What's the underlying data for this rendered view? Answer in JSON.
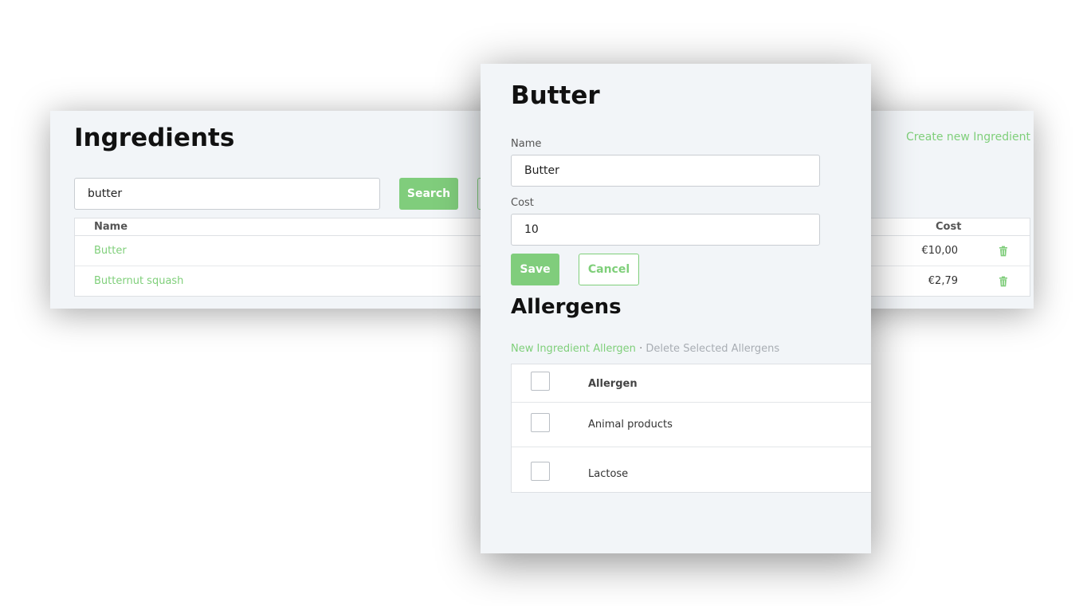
{
  "ingredients_page": {
    "title": "Ingredients",
    "create_link": "Create new Ingredient",
    "search": {
      "value": "butter",
      "button_label": "Search"
    },
    "table": {
      "columns": [
        "Name",
        "Cost"
      ],
      "rows": [
        {
          "name": "Butter",
          "cost": "€10,00"
        },
        {
          "name": "Butternut squash",
          "cost": "€2,79"
        }
      ]
    }
  },
  "edit_modal": {
    "title": "Butter",
    "fields": {
      "name_label": "Name",
      "name_value": "Butter",
      "cost_label": "Cost",
      "cost_value": "10"
    },
    "save_label": "Save",
    "cancel_label": "Cancel",
    "allergens": {
      "title": "Allergens",
      "new_link": "New Ingredient Allergen",
      "separator": "·",
      "delete_link": "Delete Selected Allergens",
      "header": "Allergen",
      "items": [
        "Animal products",
        "Lactose"
      ]
    }
  },
  "colors": {
    "accent_green": "#80cd7c",
    "panel_bg": "#f2f5f8"
  },
  "icons": {
    "delete": "trash-icon"
  }
}
